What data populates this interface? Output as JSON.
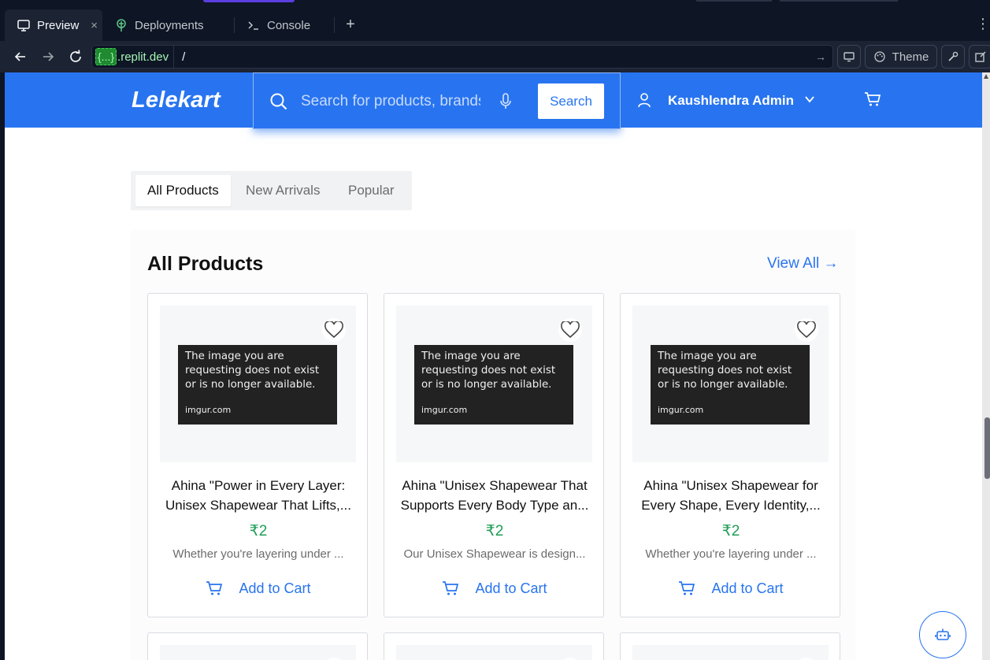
{
  "ide": {
    "tabs": [
      {
        "label": "Preview",
        "icon": "monitor-icon",
        "active": true
      },
      {
        "label": "Deployments",
        "icon": "deploy-icon",
        "active": false
      },
      {
        "label": "Console",
        "icon": "terminal-icon",
        "active": false
      }
    ],
    "close_symbol": "×",
    "add_tab_symbol": "+",
    "menu_symbol": "⋮",
    "url": {
      "prefix": "{...}",
      "domain": ".replit.dev",
      "path": "/"
    },
    "theme_label": "Theme",
    "colors": {
      "bg": "#0e1525",
      "panel": "#1c2333",
      "accent": "#5b3ee0"
    }
  },
  "site": {
    "logo": "Lelekart",
    "search": {
      "placeholder": "Search for products, brands and more",
      "button": "Search"
    },
    "user": {
      "name": "Kaushlendra Admin"
    },
    "colors": {
      "primary": "#2874f0",
      "price": "#1f9d55"
    }
  },
  "filter_tabs": [
    {
      "label": "All Products",
      "active": true
    },
    {
      "label": "New Arrivals",
      "active": false
    },
    {
      "label": "Popular",
      "active": false
    }
  ],
  "section": {
    "title": "All Products",
    "view_all": "View All →"
  },
  "broken_image": {
    "lines": [
      "The image you are",
      "requesting does not exist",
      "or is no longer available."
    ],
    "site": "imgur.com"
  },
  "products": [
    {
      "name_line1": "Ahina \"Power in Every Layer:",
      "name_line2": "Unisex Shapewear That Lifts,...",
      "price": "₹2",
      "description": "Whether you're layering under ...",
      "add_to_cart": "Add to Cart"
    },
    {
      "name_line1": "Ahina \"Unisex Shapewear That",
      "name_line2": "Supports Every Body Type an...",
      "price": "₹2",
      "description": "Our Unisex Shapewear is design...",
      "add_to_cart": "Add to Cart"
    },
    {
      "name_line1": "Ahina \"Unisex Shapewear for",
      "name_line2": "Every Shape, Every Identity,...",
      "price": "₹2",
      "description": "Whether you're layering under ...",
      "add_to_cart": "Add to Cart"
    }
  ]
}
